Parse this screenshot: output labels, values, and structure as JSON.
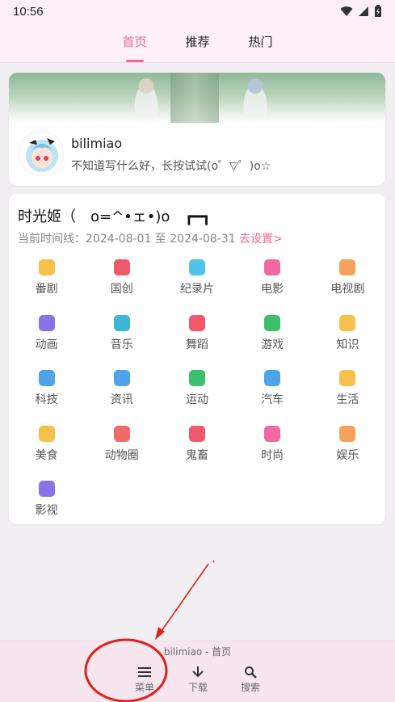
{
  "status_bar": {
    "time": "10:56"
  },
  "top_tabs": [
    {
      "label": "首页",
      "active": true
    },
    {
      "label": "推荐",
      "active": false
    },
    {
      "label": "热门",
      "active": false
    }
  ],
  "profile": {
    "name": "bilimiao",
    "signature": "不知道写什么好，长按试试(o゜▽゜)o☆"
  },
  "time_machine": {
    "title": "时光姬（　o=^•ェ•)o　┏━┓",
    "range_prefix": "当前时间线：2024-08-01 至 2024-08-31",
    "range_link": "去设置>",
    "categories": [
      {
        "label": "番剧",
        "icon": "tv-icon",
        "color": "#f6c04d"
      },
      {
        "label": "国创",
        "icon": "chili-icon",
        "color": "#ef5a6b"
      },
      {
        "label": "纪录片",
        "icon": "whale-icon",
        "color": "#4fc3e8"
      },
      {
        "label": "电影",
        "icon": "3d-glasses-icon",
        "color": "#f06aa1"
      },
      {
        "label": "电视剧",
        "icon": "sofa-icon",
        "color": "#f7a25a"
      },
      {
        "label": "动画",
        "icon": "play-icon",
        "color": "#8a73e6"
      },
      {
        "label": "音乐",
        "icon": "headphones-icon",
        "color": "#3fb6d8"
      },
      {
        "label": "舞蹈",
        "icon": "fan-icon",
        "color": "#ef5a6b"
      },
      {
        "label": "游戏",
        "icon": "creeper-icon",
        "color": "#3dbf6e"
      },
      {
        "label": "知识",
        "icon": "lightbulb-icon",
        "color": "#f6c04d"
      },
      {
        "label": "科技",
        "icon": "ufo-icon",
        "color": "#4fa3e8"
      },
      {
        "label": "资讯",
        "icon": "news-icon",
        "color": "#4fa3e8"
      },
      {
        "label": "运动",
        "icon": "runner-icon",
        "color": "#3dbf6e"
      },
      {
        "label": "汽车",
        "icon": "car-icon",
        "color": "#4fa3e8"
      },
      {
        "label": "生活",
        "icon": "duck-icon",
        "color": "#f6c04d"
      },
      {
        "label": "美食",
        "icon": "bell-icon",
        "color": "#f6c04d"
      },
      {
        "label": "动物圈",
        "icon": "paw-icon",
        "color": "#f06a6a"
      },
      {
        "label": "鬼畜",
        "icon": "lion-icon",
        "color": "#ef5a6b"
      },
      {
        "label": "时尚",
        "icon": "dress-icon",
        "color": "#f06aa1"
      },
      {
        "label": "娱乐",
        "icon": "magic-wand-icon",
        "color": "#f7a25a"
      },
      {
        "label": "影视",
        "icon": "clapper-icon",
        "color": "#8a73e6"
      }
    ]
  },
  "bottom_bar": {
    "title": "bilimiao - 首页",
    "buttons": [
      {
        "label": "菜单",
        "icon": "menu-icon"
      },
      {
        "label": "下载",
        "icon": "download-icon"
      },
      {
        "label": "搜索",
        "icon": "search-icon"
      }
    ]
  },
  "annotation": {
    "color": "#e0201c"
  }
}
